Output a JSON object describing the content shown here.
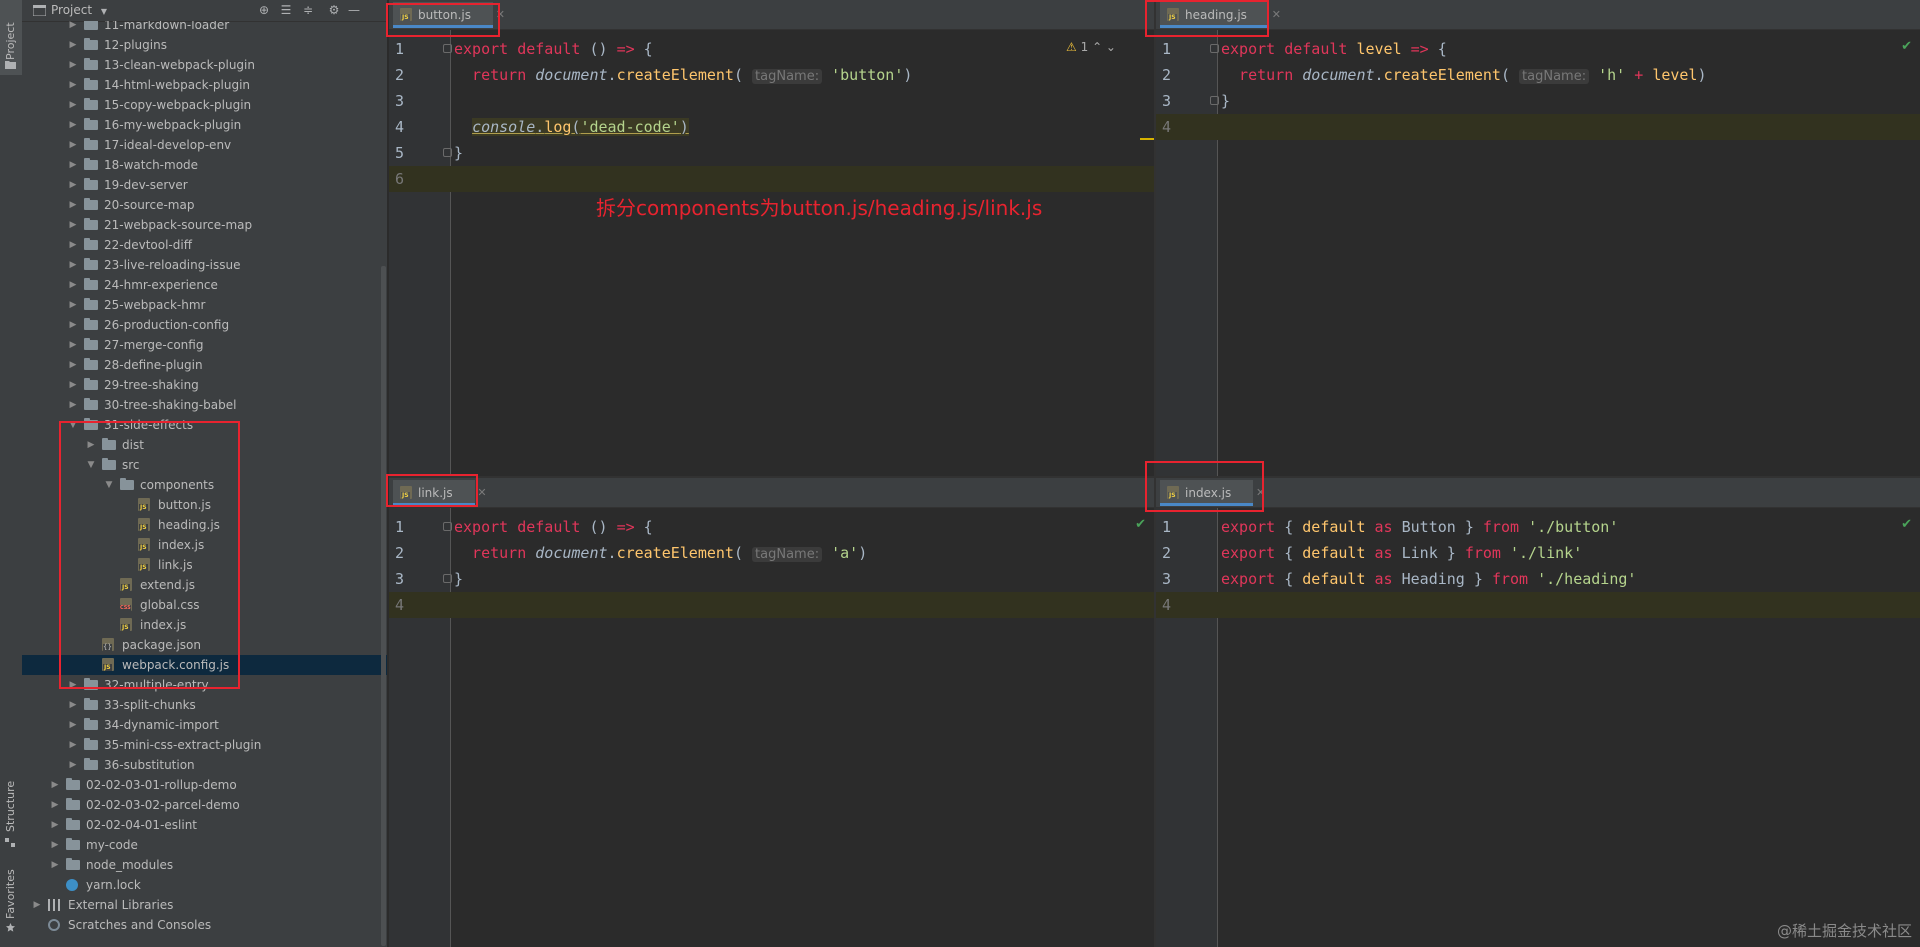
{
  "toolwindows": {
    "project": "Project",
    "structure": "Structure",
    "favorites": "Favorites"
  },
  "project_panel": {
    "title": "Project",
    "tree": [
      {
        "label": "11-markdown-loader",
        "kind": "folder",
        "depth": 2,
        "open": false
      },
      {
        "label": "12-plugins",
        "kind": "folder",
        "depth": 2,
        "open": false
      },
      {
        "label": "13-clean-webpack-plugin",
        "kind": "folder",
        "depth": 2,
        "open": false
      },
      {
        "label": "14-html-webpack-plugin",
        "kind": "folder",
        "depth": 2,
        "open": false
      },
      {
        "label": "15-copy-webpack-plugin",
        "kind": "folder",
        "depth": 2,
        "open": false
      },
      {
        "label": "16-my-webpack-plugin",
        "kind": "folder",
        "depth": 2,
        "open": false
      },
      {
        "label": "17-ideal-develop-env",
        "kind": "folder",
        "depth": 2,
        "open": false
      },
      {
        "label": "18-watch-mode",
        "kind": "folder",
        "depth": 2,
        "open": false
      },
      {
        "label": "19-dev-server",
        "kind": "folder",
        "depth": 2,
        "open": false
      },
      {
        "label": "20-source-map",
        "kind": "folder",
        "depth": 2,
        "open": false
      },
      {
        "label": "21-webpack-source-map",
        "kind": "folder",
        "depth": 2,
        "open": false
      },
      {
        "label": "22-devtool-diff",
        "kind": "folder",
        "depth": 2,
        "open": false
      },
      {
        "label": "23-live-reloading-issue",
        "kind": "folder",
        "depth": 2,
        "open": false
      },
      {
        "label": "24-hmr-experience",
        "kind": "folder",
        "depth": 2,
        "open": false
      },
      {
        "label": "25-webpack-hmr",
        "kind": "folder",
        "depth": 2,
        "open": false
      },
      {
        "label": "26-production-config",
        "kind": "folder",
        "depth": 2,
        "open": false
      },
      {
        "label": "27-merge-config",
        "kind": "folder",
        "depth": 2,
        "open": false
      },
      {
        "label": "28-define-plugin",
        "kind": "folder",
        "depth": 2,
        "open": false
      },
      {
        "label": "29-tree-shaking",
        "kind": "folder",
        "depth": 2,
        "open": false
      },
      {
        "label": "30-tree-shaking-babel",
        "kind": "folder",
        "depth": 2,
        "open": false
      },
      {
        "label": "31-side-effects",
        "kind": "folder",
        "depth": 2,
        "open": true
      },
      {
        "label": "dist",
        "kind": "folder",
        "depth": 3,
        "open": false
      },
      {
        "label": "src",
        "kind": "folder",
        "depth": 3,
        "open": true
      },
      {
        "label": "components",
        "kind": "folder",
        "depth": 4,
        "open": true
      },
      {
        "label": "button.js",
        "kind": "js",
        "depth": 5
      },
      {
        "label": "heading.js",
        "kind": "js",
        "depth": 5
      },
      {
        "label": "index.js",
        "kind": "js",
        "depth": 5
      },
      {
        "label": "link.js",
        "kind": "js",
        "depth": 5
      },
      {
        "label": "extend.js",
        "kind": "js",
        "depth": 4
      },
      {
        "label": "global.css",
        "kind": "css",
        "depth": 4
      },
      {
        "label": "index.js",
        "kind": "js",
        "depth": 4
      },
      {
        "label": "package.json",
        "kind": "json",
        "depth": 3
      },
      {
        "label": "webpack.config.js",
        "kind": "js",
        "depth": 3,
        "selected": true
      },
      {
        "label": "32-multiple-entry",
        "kind": "folder",
        "depth": 2,
        "open": false
      },
      {
        "label": "33-split-chunks",
        "kind": "folder",
        "depth": 2,
        "open": false
      },
      {
        "label": "34-dynamic-import",
        "kind": "folder",
        "depth": 2,
        "open": false
      },
      {
        "label": "35-mini-css-extract-plugin",
        "kind": "folder",
        "depth": 2,
        "open": false
      },
      {
        "label": "36-substitution",
        "kind": "folder",
        "depth": 2,
        "open": false
      },
      {
        "label": "02-02-03-01-rollup-demo",
        "kind": "folder",
        "depth": 1,
        "open": false
      },
      {
        "label": "02-02-03-02-parcel-demo",
        "kind": "folder",
        "depth": 1,
        "open": false
      },
      {
        "label": "02-02-04-01-eslint",
        "kind": "folder",
        "depth": 1,
        "open": false
      },
      {
        "label": "my-code",
        "kind": "folder",
        "depth": 1,
        "open": false
      },
      {
        "label": "node_modules",
        "kind": "folder",
        "depth": 1,
        "open": false
      },
      {
        "label": "yarn.lock",
        "kind": "yarn",
        "depth": 1
      },
      {
        "label": "External Libraries",
        "kind": "lib",
        "depth": 0,
        "open": false
      },
      {
        "label": "Scratches and Consoles",
        "kind": "scratch",
        "depth": 0
      }
    ]
  },
  "editors": {
    "top_left": {
      "tab": "button.js",
      "warning_count": "1",
      "lines": [
        [
          [
            "export default ",
            "kwr"
          ],
          [
            "() ",
            ""
          ],
          [
            "=> ",
            "kwr"
          ],
          [
            "{",
            ""
          ]
        ],
        [
          [
            "  return ",
            "kwr"
          ],
          [
            "document",
            "it"
          ],
          [
            ".",
            ""
          ],
          [
            "createElement",
            "fn"
          ],
          [
            "( ",
            ""
          ],
          [
            "tagName:",
            "hint"
          ],
          [
            " ",
            ""
          ],
          [
            "'button'",
            "strg"
          ],
          [
            ")",
            ""
          ]
        ],
        [],
        [
          [
            "  ",
            ""
          ],
          [
            "console",
            "it dead"
          ],
          [
            ".",
            "dead"
          ],
          [
            "log",
            "fn dead"
          ],
          [
            "(",
            "dead"
          ],
          [
            "'dead-code'",
            "strg dead"
          ],
          [
            ")",
            "dead"
          ]
        ],
        [
          [
            "}",
            ""
          ]
        ],
        []
      ],
      "line_numbers": [
        "1",
        "2",
        "3",
        "4",
        "5",
        "6"
      ]
    },
    "top_right": {
      "tab": "heading.js",
      "lines": [
        [
          [
            "export default ",
            "kwr"
          ],
          [
            "level ",
            "fn"
          ],
          [
            "=> ",
            "kwr"
          ],
          [
            "{",
            ""
          ]
        ],
        [
          [
            "  return ",
            "kwr"
          ],
          [
            "document",
            "it"
          ],
          [
            ".",
            ""
          ],
          [
            "createElement",
            "fn"
          ],
          [
            "( ",
            ""
          ],
          [
            "tagName:",
            "hint"
          ],
          [
            " ",
            ""
          ],
          [
            "'h' ",
            "strg"
          ],
          [
            "+ ",
            "kwr"
          ],
          [
            "level",
            "fn"
          ],
          [
            ")",
            ""
          ]
        ],
        [
          [
            "}",
            ""
          ]
        ],
        []
      ],
      "line_numbers": [
        "1",
        "2",
        "3",
        "4"
      ]
    },
    "bottom_left": {
      "tab": "link.js",
      "lines": [
        [
          [
            "export default ",
            "kwr"
          ],
          [
            "() ",
            ""
          ],
          [
            "=> ",
            "kwr"
          ],
          [
            "{",
            ""
          ]
        ],
        [
          [
            "  return ",
            "kwr"
          ],
          [
            "document",
            "it"
          ],
          [
            ".",
            ""
          ],
          [
            "createElement",
            "fn"
          ],
          [
            "( ",
            ""
          ],
          [
            "tagName:",
            "hint"
          ],
          [
            " ",
            ""
          ],
          [
            "'a'",
            "strg"
          ],
          [
            ")",
            ""
          ]
        ],
        [
          [
            "}",
            ""
          ]
        ],
        []
      ],
      "line_numbers": [
        "1",
        "2",
        "3",
        "4"
      ]
    },
    "bottom_right": {
      "tab": "index.js",
      "lines": [
        [
          [
            "export ",
            "kwr"
          ],
          [
            "{ ",
            ""
          ],
          [
            "default ",
            "fn"
          ],
          [
            "as ",
            "kwr"
          ],
          [
            "Button ",
            ""
          ],
          [
            "} ",
            ""
          ],
          [
            "from ",
            "kwr"
          ],
          [
            "'./button'",
            "strg"
          ]
        ],
        [
          [
            "export ",
            "kwr"
          ],
          [
            "{ ",
            ""
          ],
          [
            "default ",
            "fn"
          ],
          [
            "as ",
            "kwr"
          ],
          [
            "Link ",
            ""
          ],
          [
            "} ",
            ""
          ],
          [
            "from ",
            "kwr"
          ],
          [
            "'./link'",
            "strg"
          ]
        ],
        [
          [
            "export ",
            "kwr"
          ],
          [
            "{ ",
            ""
          ],
          [
            "default ",
            "fn"
          ],
          [
            "as ",
            "kwr"
          ],
          [
            "Heading ",
            ""
          ],
          [
            "} ",
            ""
          ],
          [
            "from ",
            "kwr"
          ],
          [
            "'./heading'",
            "strg"
          ]
        ],
        []
      ],
      "line_numbers": [
        "1",
        "2",
        "3",
        "4"
      ]
    }
  },
  "annotation": "拆分components为button.js/heading.js/link.js",
  "watermark": "@稀土掘金技术社区",
  "colors": {
    "annotation_red": "#e8232f",
    "background": "#2b2b2b",
    "panel": "#3c3f41",
    "selection": "#0d293e"
  }
}
